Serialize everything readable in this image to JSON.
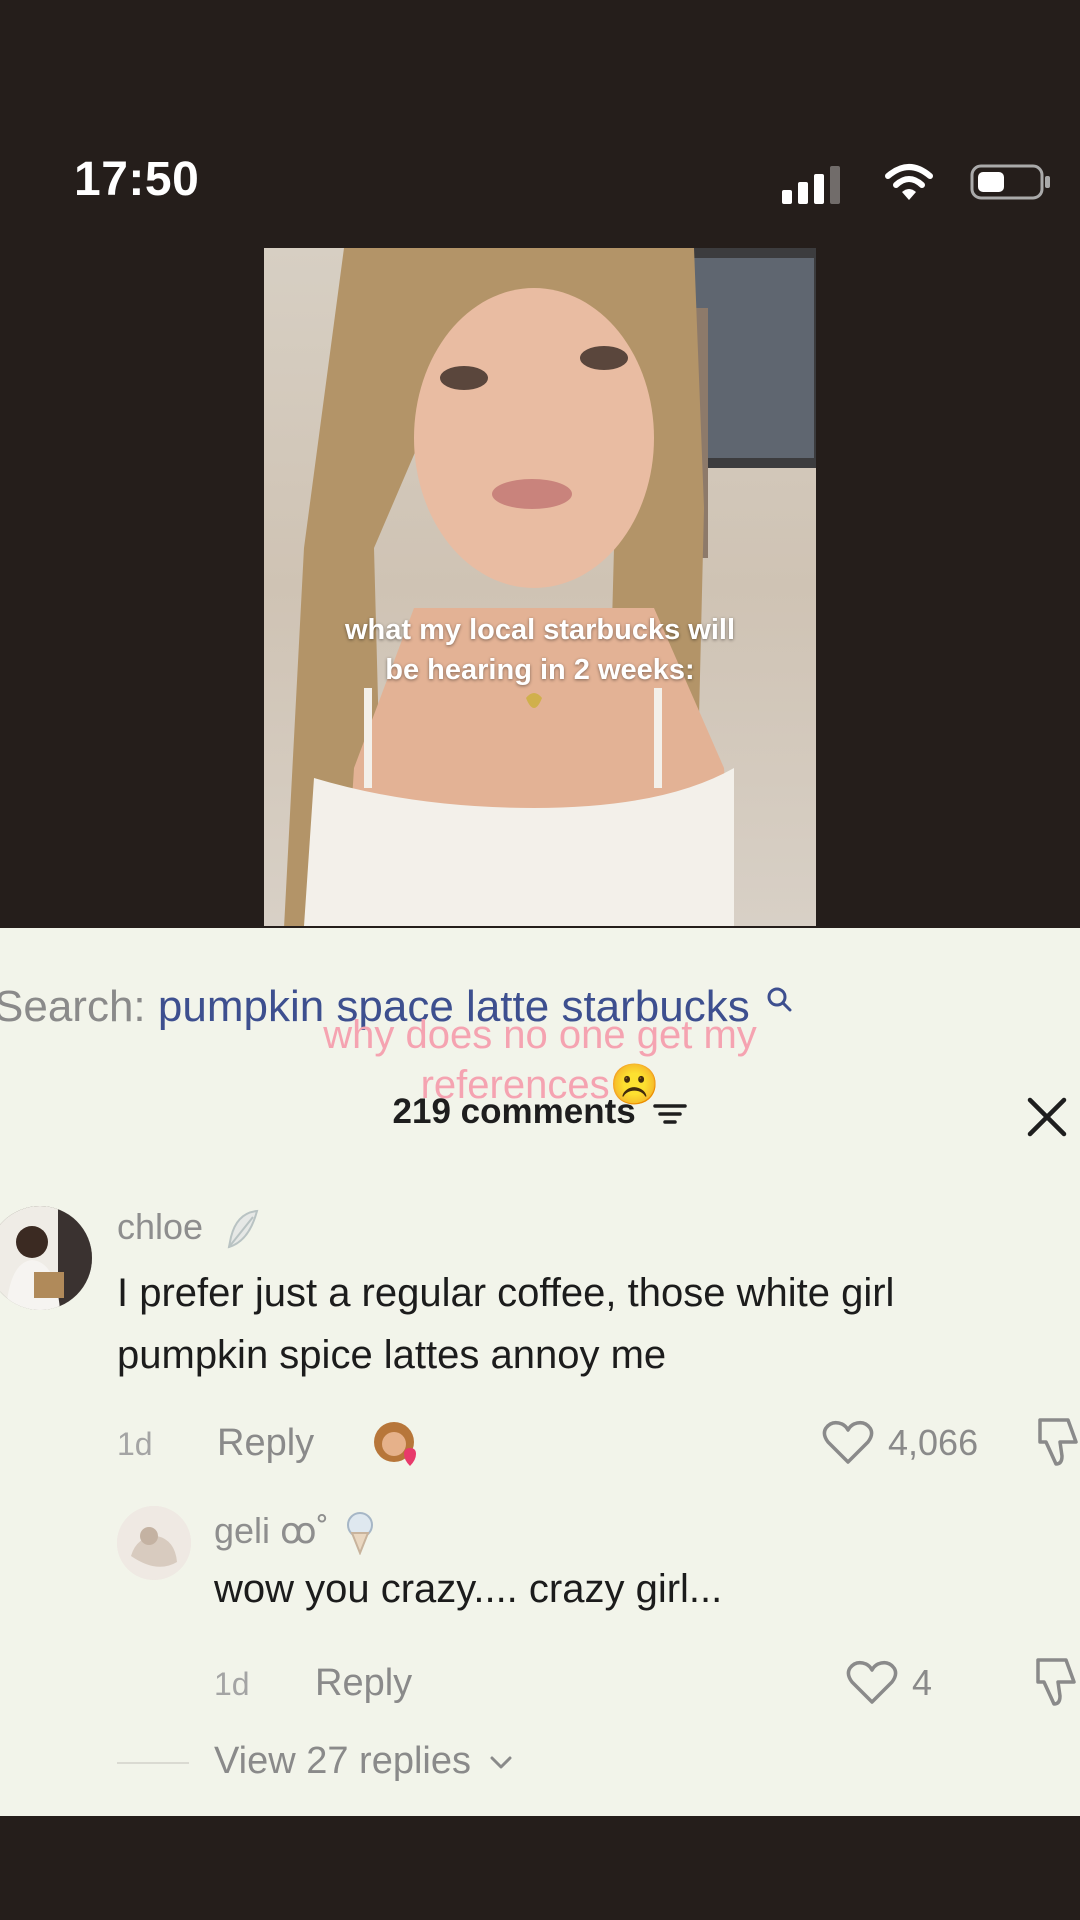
{
  "status_bar": {
    "time": "17:50"
  },
  "video": {
    "caption_line1": "what my local starbucks will",
    "caption_line2": "be hearing in 2 weeks:"
  },
  "panel": {
    "search_label": "Search:",
    "search_query": "pumpkin space latte starbucks",
    "overlay_line1": "why does no one get my",
    "overlay_line2": "references☹️",
    "comments_title": "219 comments"
  },
  "comments": [
    {
      "username": "chloe",
      "text_line1": "I prefer just a regular coffee, those white girl",
      "text_line2": "pumpkin spice lattes annoy me",
      "time": "1d",
      "reply_label": "Reply",
      "likes": "4,066"
    },
    {
      "username": "geli ꝏ˚ ",
      "text": "wow you crazy.... crazy girl...",
      "time": "1d",
      "reply_label": "Reply",
      "likes": "4"
    }
  ],
  "view_replies": "View 27 replies",
  "colors": {
    "pink_overlay": "#f5a3b1",
    "search_query": "#3d4f8f",
    "panel_bg": "#f2f4ea"
  },
  "icons": [
    "signal-icon",
    "wifi-icon",
    "battery-icon",
    "search-icon",
    "filter-icon",
    "close-icon",
    "heart-icon",
    "dislike-icon",
    "chevron-down-icon",
    "feather-icon"
  ]
}
